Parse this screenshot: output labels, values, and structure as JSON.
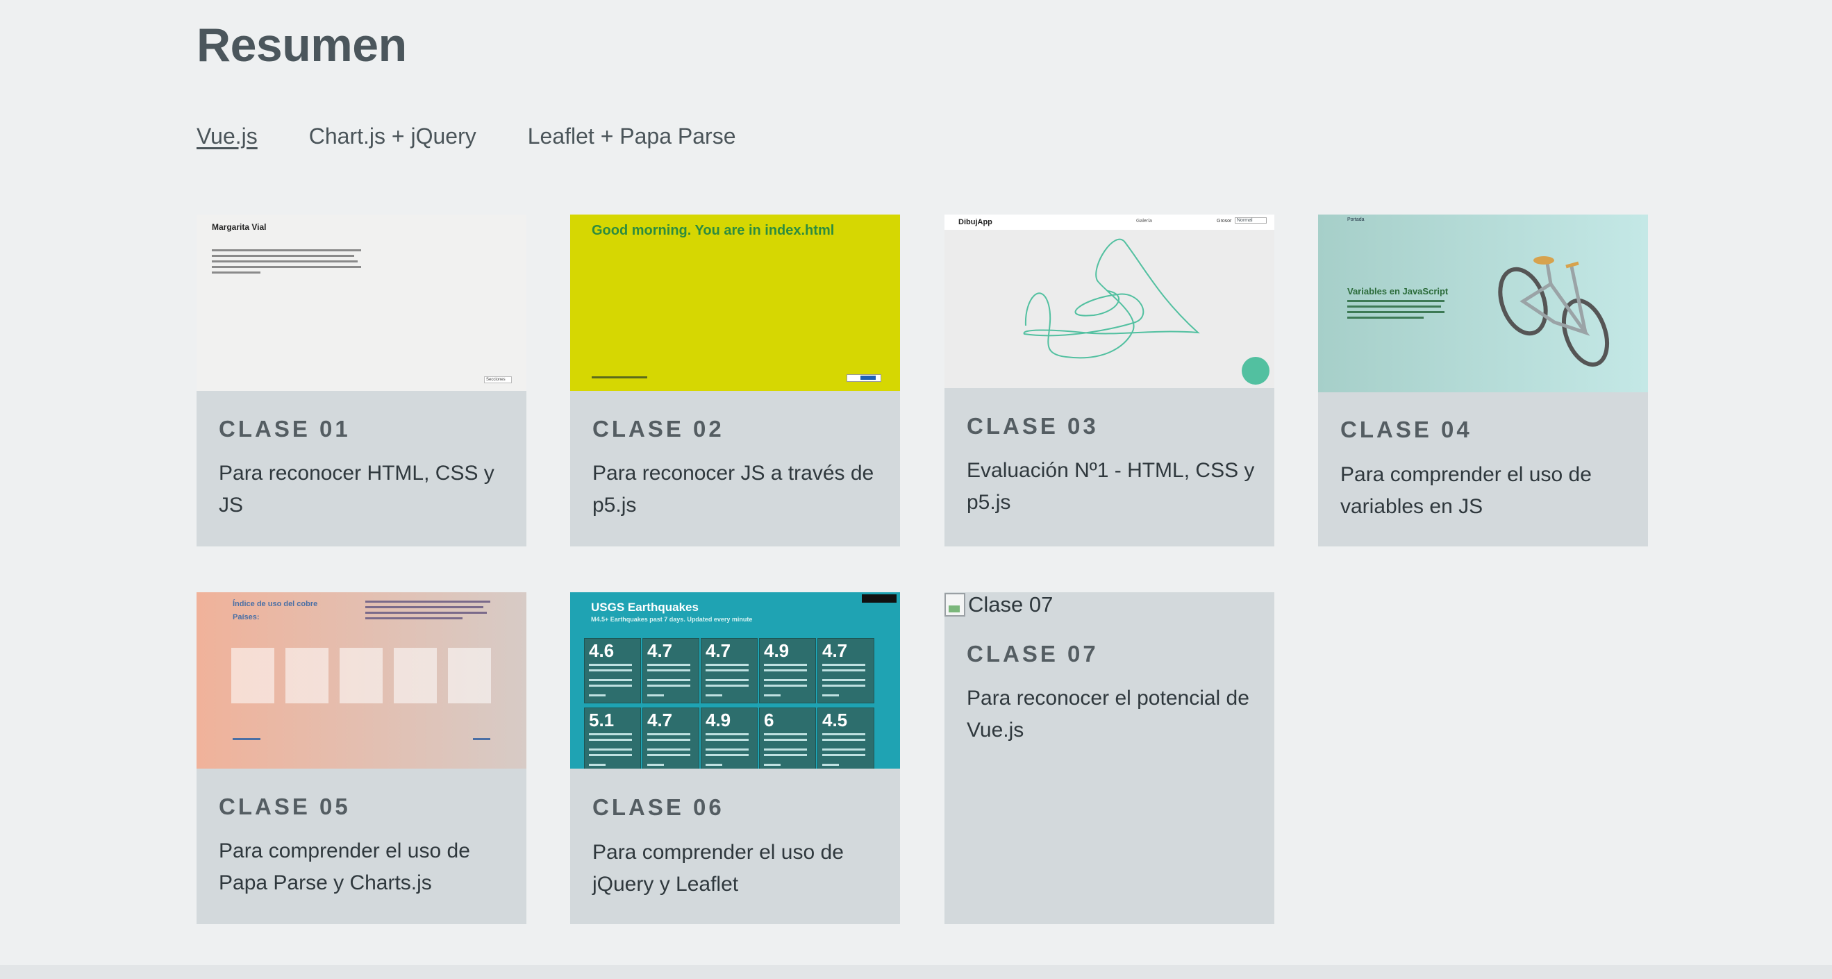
{
  "page": {
    "title": "Resumen"
  },
  "nav": [
    {
      "label": "Vue.js",
      "active": true
    },
    {
      "label": "Chart.js + jQuery",
      "active": false
    },
    {
      "label": "Leaflet + Papa Parse",
      "active": false
    }
  ],
  "cards": [
    {
      "title": "CLASE 01",
      "description": "Para reconocer HTML, CSS y JS",
      "thumb": {
        "heading": "Margarita Vial",
        "select": "Secciones"
      }
    },
    {
      "title": "CLASE 02",
      "description": "Para reconocer JS a través de p5.js",
      "thumb": {
        "heading": "Good morning. You are in index.html"
      }
    },
    {
      "title": "CLASE 03",
      "description": "Evaluación Nº1 - HTML, CSS y p5.js",
      "thumb": {
        "brand": "DibujApp",
        "center": "Galería",
        "label": "Grosor",
        "select": "Normal"
      }
    },
    {
      "title": "CLASE 04",
      "description": "Para comprender el uso de variables en JS",
      "thumb": {
        "heading": "Variables en JavaScript",
        "nav": "Portada"
      }
    },
    {
      "title": "CLASE 05",
      "description": "Para comprender el uso de Papa Parse y Charts.js",
      "thumb": {
        "heading": "Índice de uso del cobre",
        "subheading": "Países:"
      }
    },
    {
      "title": "CLASE 06",
      "description": "Para comprender el uso de jQuery y Leaflet",
      "thumb": {
        "heading": "USGS Earthquakes",
        "subheading": "M4.5+ Earthquakes past 7 days. Updated every minute",
        "magnitudes": [
          "4.6",
          "4.7",
          "4.7",
          "4.9",
          "4.7",
          "5.1",
          "4.7",
          "4.9",
          "6",
          "4.5"
        ]
      }
    },
    {
      "title": "CLASE 07",
      "description": "Para reconocer el potencial de Vue.js",
      "thumb": {
        "alt": "Clase 07"
      }
    }
  ],
  "colors": {
    "background": "#eef0f1",
    "card": "#d3d9dc",
    "yellow": "#d6d702",
    "teal": "#1fa3b3",
    "mint": "#52c0a0"
  }
}
